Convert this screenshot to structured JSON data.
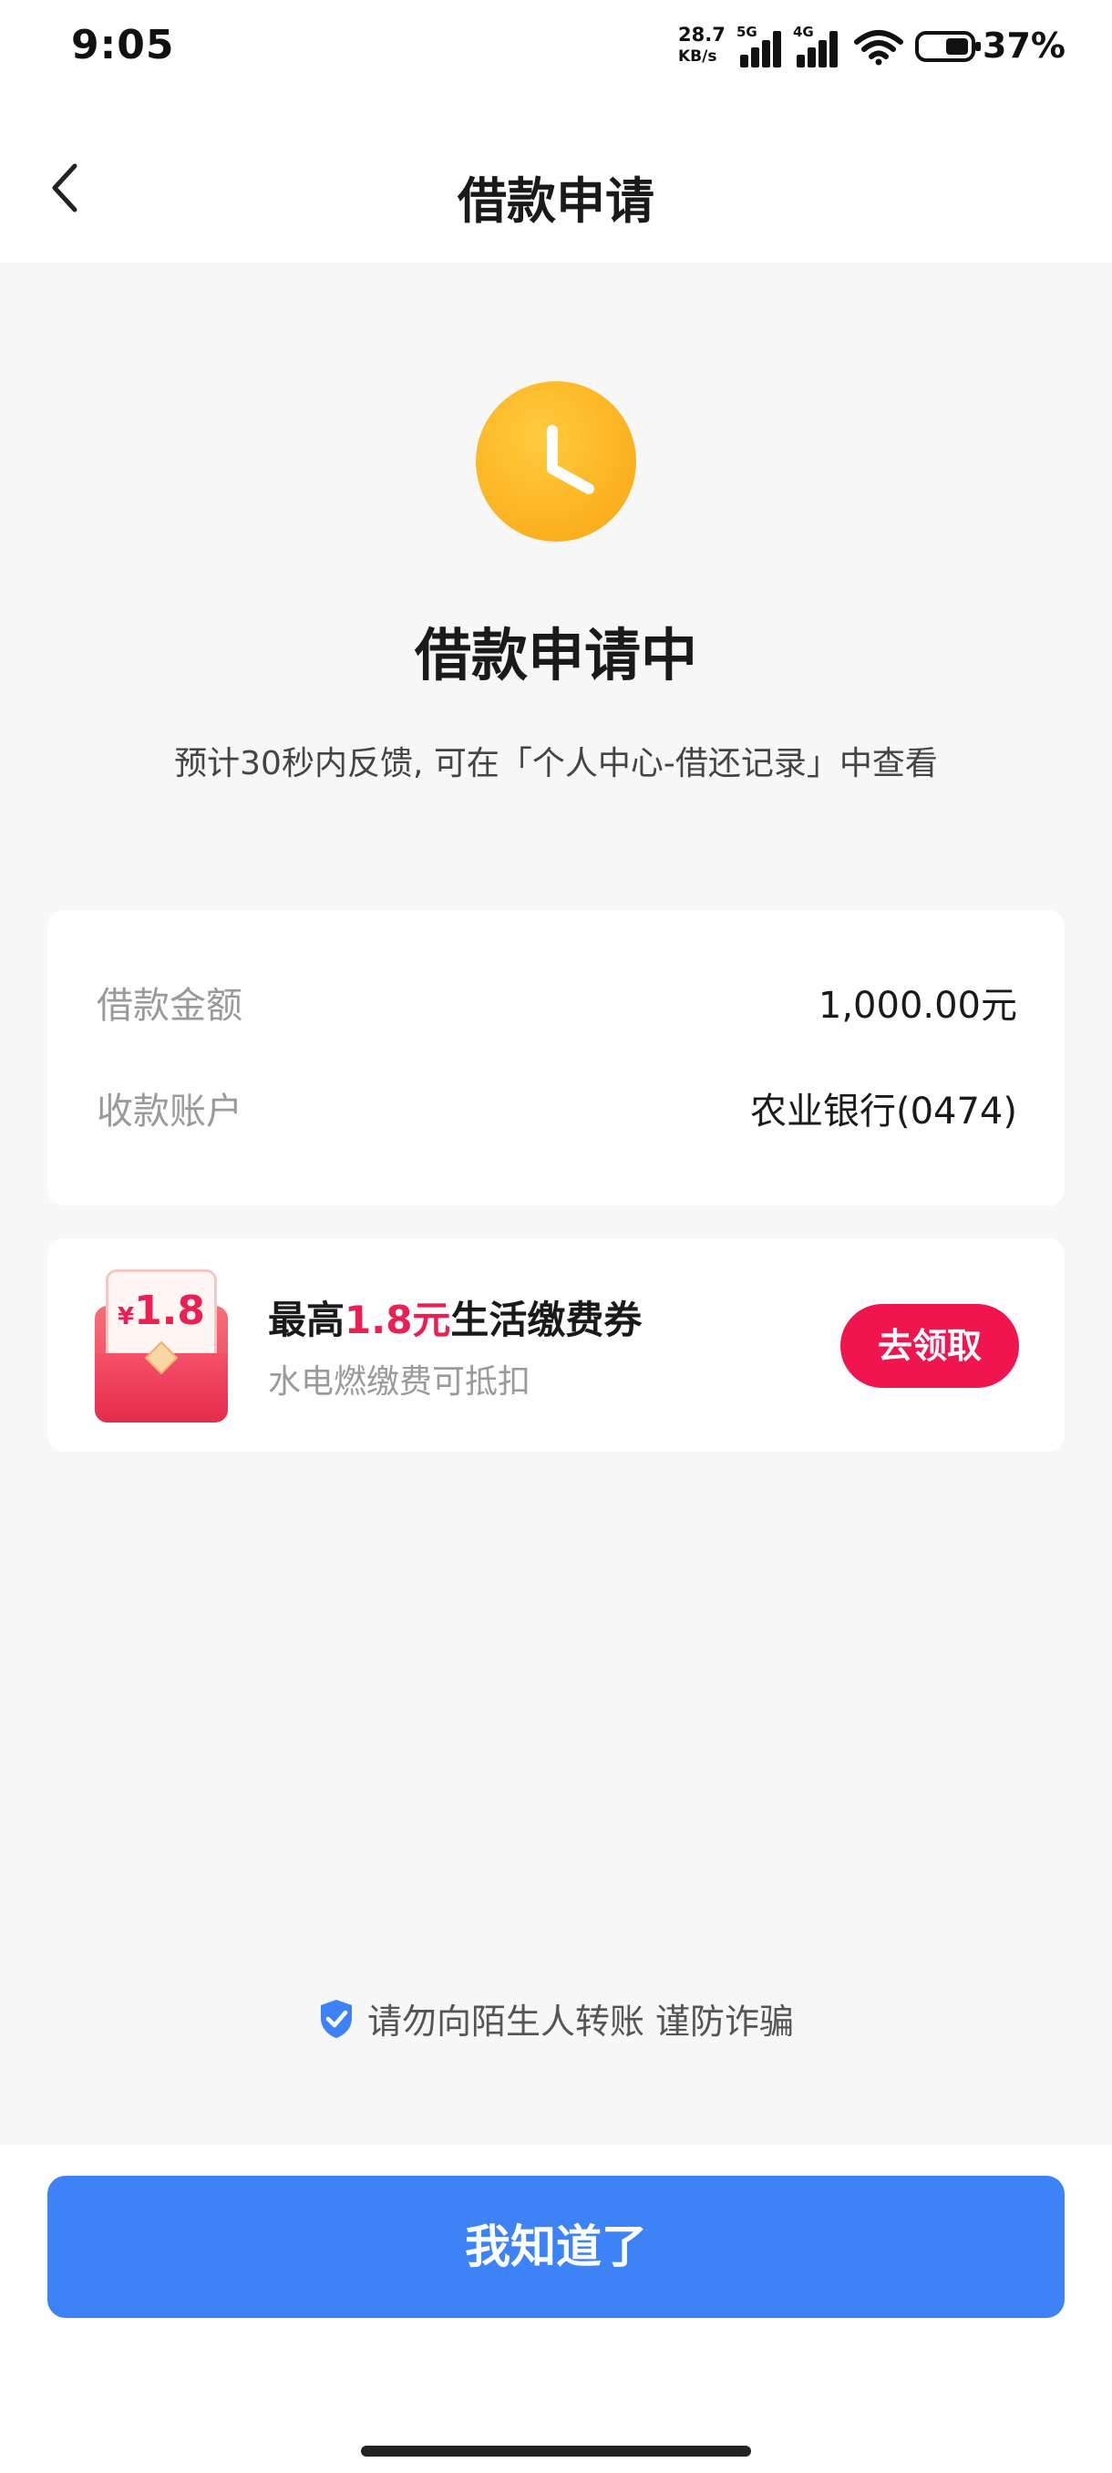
{
  "status_bar": {
    "time": "9:05",
    "network_speed": "28.7",
    "network_unit": "KB/s",
    "sim1_label": "5G",
    "sim2_label": "4G",
    "battery": "37%"
  },
  "nav": {
    "back_icon": "chevron-left-icon",
    "title": "借款申请"
  },
  "status": {
    "icon": "clock-icon",
    "icon_color": "#FBB01F",
    "title": "借款申请中",
    "subtitle": "预计30秒内反馈, 可在「个人中心-借还记录」中查看"
  },
  "info": {
    "rows": [
      {
        "label": "借款金额",
        "value": "1,000.00元"
      },
      {
        "label": "收款账户",
        "value": "农业银行(0474)"
      }
    ]
  },
  "coupon": {
    "badge_currency": "¥",
    "badge_amount": "1.8",
    "title_prefix": "最高",
    "title_highlight": "1.8元",
    "title_suffix": "生活缴费券",
    "subtitle": "水电燃缴费可抵扣",
    "claim_label": "去领取",
    "accent_color": "#F0154F"
  },
  "tip": {
    "icon": "shield-check-icon",
    "text": "请勿向陌生人转账 谨防诈骗"
  },
  "primary_button": {
    "label": "我知道了",
    "color": "#3D82F6"
  }
}
